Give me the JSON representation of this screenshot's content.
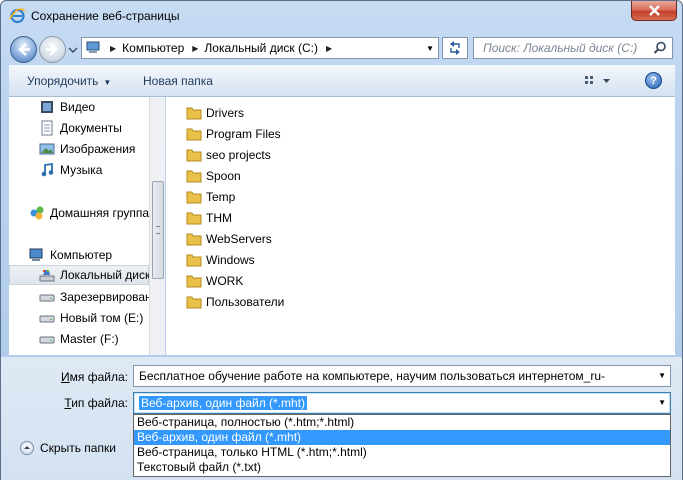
{
  "window": {
    "title": "Сохранение веб-страницы",
    "icon": "internet-explorer-icon"
  },
  "address": {
    "crumbs": [
      "Компьютер",
      "Локальный диск (C:)"
    ]
  },
  "search": {
    "placeholder": "Поиск: Локальный диск (C:)"
  },
  "toolbar": {
    "organize_label": "Упорядочить",
    "new_folder_label": "Новая папка",
    "help_label": "?"
  },
  "sidebar": {
    "items": [
      {
        "label": "Видео",
        "icon": "video-library-icon"
      },
      {
        "label": "Документы",
        "icon": "documents-library-icon"
      },
      {
        "label": "Изображения",
        "icon": "pictures-library-icon"
      },
      {
        "label": "Музыка",
        "icon": "music-library-icon"
      },
      {
        "label": "Домашняя группа",
        "icon": "homegroup-icon"
      },
      {
        "label": "Компьютер",
        "icon": "computer-icon"
      },
      {
        "label": "Локальный диск (C:)",
        "icon": "local-disk-icon",
        "selected": true
      },
      {
        "label": "Зарезервировано системой",
        "icon": "drive-icon"
      },
      {
        "label": "Новый том (E:)",
        "icon": "drive-icon"
      },
      {
        "label": "Master (F:)",
        "icon": "drive-icon"
      }
    ]
  },
  "files": [
    "Drivers",
    "Program Files",
    "seo projects",
    "Spoon",
    "Temp",
    "THM",
    "WebServers",
    "Windows",
    "WORK",
    "Пользователи"
  ],
  "form": {
    "filename_label_u": "И",
    "filename_label_rest": "мя файла:",
    "filename_value": "Бесплатное обучение работе на компьютере, научим пользоваться интернетом_ru-",
    "filetype_label_u": "Т",
    "filetype_label_rest": "ип файла:",
    "filetype_value": "Веб-архив, один файл (*.mht)",
    "hide_folders_label": "Скрыть папки"
  },
  "filetype_options": [
    {
      "label": "Веб-страница, полностью (*.htm;*.html)",
      "highlighted": false
    },
    {
      "label": "Веб-архив, один файл (*.mht)",
      "highlighted": true
    },
    {
      "label": "Веб-страница, только HTML (*.htm;*.html)",
      "highlighted": false
    },
    {
      "label": "Текстовый файл (*.txt)",
      "highlighted": false
    }
  ],
  "colors": {
    "selection": "#3399ff",
    "folder": "#e8c04a",
    "close_button": "#c3412b"
  }
}
